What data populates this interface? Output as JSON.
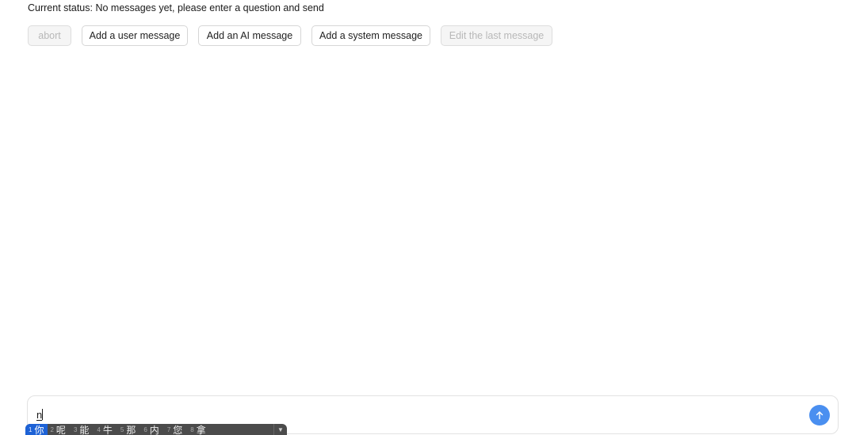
{
  "status": {
    "text": "Current status: No messages yet, please enter a question and send"
  },
  "toolbar": {
    "abort_label": "abort",
    "add_user_label": "Add a user message",
    "add_ai_label": "Add an AI message",
    "add_system_label": "Add a system message",
    "edit_last_label": "Edit the last message"
  },
  "composer": {
    "value": "n",
    "send_icon": "arrow-up-icon",
    "accent_color": "#4a8ff0"
  },
  "ime": {
    "candidates": [
      {
        "num": "1",
        "char": "你"
      },
      {
        "num": "2",
        "char": "呢"
      },
      {
        "num": "3",
        "char": "能"
      },
      {
        "num": "4",
        "char": "牛"
      },
      {
        "num": "5",
        "char": "那"
      },
      {
        "num": "6",
        "char": "内"
      },
      {
        "num": "7",
        "char": "您"
      },
      {
        "num": "8",
        "char": "拿"
      }
    ],
    "more_icon": "chevron-down-icon"
  }
}
